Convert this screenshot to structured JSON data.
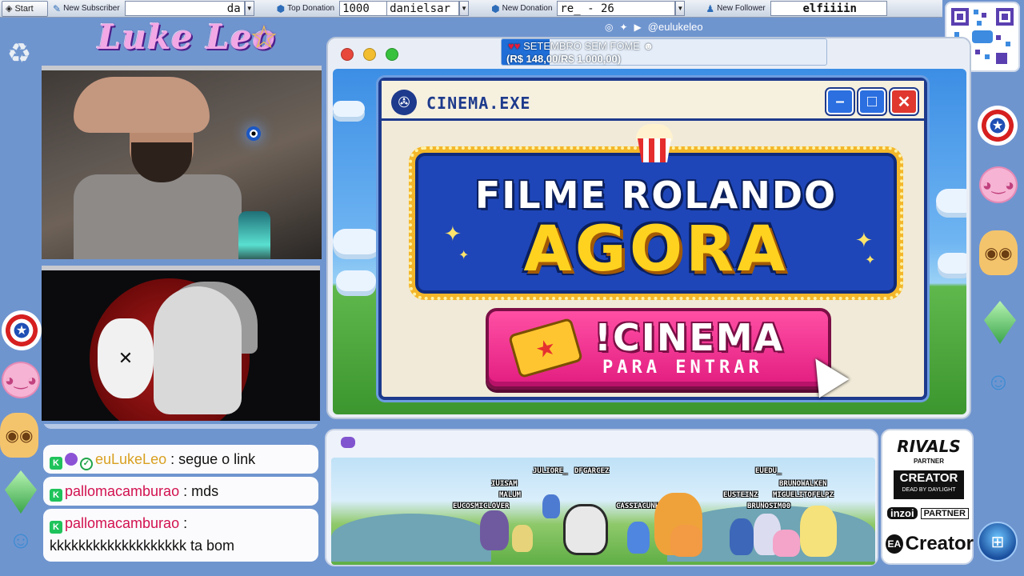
{
  "topbar": {
    "start_label": "Start",
    "start_field": "da",
    "subscriber_label": "New Subscriber",
    "donation_label": "Top Donation",
    "top_donation_amount": "1000",
    "top_donation_name": "danielsar",
    "new_donation_label": "New Donation",
    "new_donation_value": "re_ - 26",
    "follower_label": "New Follower",
    "follower_value": "elfiiiin"
  },
  "logo_text": "Luke Leo",
  "social": {
    "handle": "@eulukeleo",
    "icons": [
      "instagram-icon",
      "twitter-icon",
      "youtube-icon"
    ]
  },
  "donation_goal": {
    "title": "SETEMBRO SEM FOME",
    "amount": "(R$ 148,00/R$ 1.000,00)",
    "progress_fraction": 0.148
  },
  "cinema_window": {
    "title": "CINEMA.EXE",
    "headline_line1": "FILME ROLANDO",
    "headline_line2": "AGORA",
    "command": "!CINEMA",
    "command_sub": "PARA ENTRAR"
  },
  "chat": {
    "messages": [
      {
        "user": "euLukeLeo",
        "text": " : segue o link"
      },
      {
        "user": "pallomacamburao",
        "text": " : mds"
      },
      {
        "user": "pallomacamburao",
        "text": " :",
        "text2": "kkkkkkkkkkkkkkkkkkk ta bom"
      }
    ]
  },
  "community": {
    "names": [
      "IUISAM",
      "JULIORE_",
      "DFGARCEZ",
      "MALUM",
      "EUCOSMICLOVER",
      "CASSIACUNH4",
      "EUEDU_",
      "BRUNOWALKEN",
      "EUSTEINZ",
      "MIGUELITOFELPZ",
      "BRUNOSIM00"
    ]
  },
  "partners": {
    "rivals": "RIVALS",
    "rivals_sub": "PARTNER",
    "creator": "CREATOR",
    "creator_sub": "DEAD BY DAYLIGHT",
    "inzoi": "inzoi",
    "inzoi_sub": "PARTNER",
    "ea_creator": "Creator",
    "ea_logo": "EA"
  },
  "colors": {
    "background": "#6f95cf",
    "accent_blue": "#1d3a8c",
    "cta_pink": "#e21d80",
    "headline_gold": "#ffd21f"
  }
}
